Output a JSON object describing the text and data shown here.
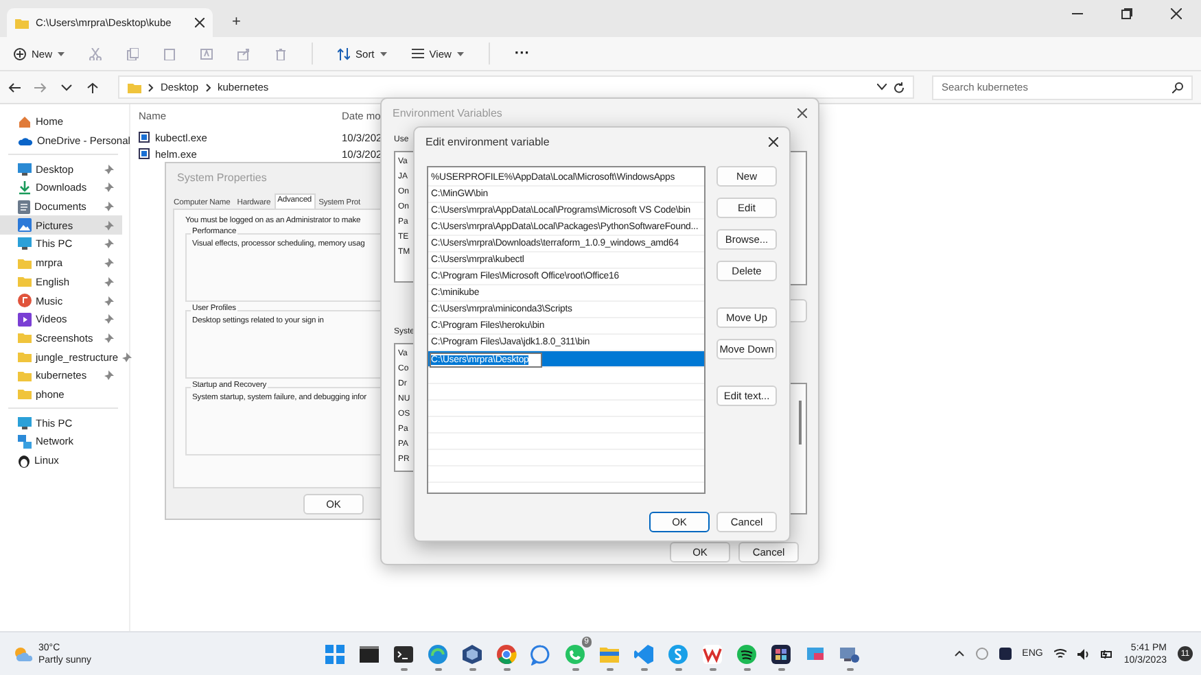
{
  "explorer": {
    "tab_title": "C:\\Users\\mrpra\\Desktop\\kube",
    "new_tab": "+",
    "toolbar": {
      "new": "New",
      "sort": "Sort",
      "view": "View",
      "more": "···"
    },
    "breadcrumb": [
      "Desktop",
      "kubernetes"
    ],
    "search": {
      "placeholder": "Search kubernetes"
    },
    "sidebar_top": [
      {
        "label": "Home",
        "kind": "home"
      },
      {
        "label": "OneDrive - Personal",
        "kind": "cloud"
      }
    ],
    "sidebar_quick": [
      {
        "label": "Desktop",
        "kind": "desktop",
        "selected": false,
        "pinned": true
      },
      {
        "label": "Downloads",
        "kind": "download",
        "selected": false,
        "pinned": true
      },
      {
        "label": "Documents",
        "kind": "document",
        "selected": false,
        "pinned": true
      },
      {
        "label": "Pictures",
        "kind": "pictures",
        "selected": true,
        "pinned": true
      },
      {
        "label": "This PC",
        "kind": "pc",
        "selected": false,
        "pinned": true
      },
      {
        "label": "mrpra",
        "kind": "folder",
        "selected": false,
        "pinned": true
      },
      {
        "label": "English",
        "kind": "folder",
        "selected": false,
        "pinned": true
      },
      {
        "label": "Music",
        "kind": "music",
        "selected": false,
        "pinned": true
      },
      {
        "label": "Videos",
        "kind": "video",
        "selected": false,
        "pinned": true
      },
      {
        "label": "Screenshots",
        "kind": "folder",
        "selected": false,
        "pinned": true
      },
      {
        "label": "jungle_restructure",
        "kind": "folder",
        "selected": false,
        "pinned": true
      },
      {
        "label": "kubernetes",
        "kind": "folder",
        "selected": false,
        "pinned": true
      },
      {
        "label": "phone",
        "kind": "folder",
        "selected": false,
        "pinned": false
      }
    ],
    "sidebar_bottom": [
      {
        "label": "This PC",
        "kind": "pc"
      },
      {
        "label": "Network",
        "kind": "network"
      },
      {
        "label": "Linux",
        "kind": "linux"
      }
    ],
    "columns": [
      "Name",
      "Date mo"
    ],
    "files": [
      {
        "name": "kubectl.exe",
        "date": "10/3/202"
      },
      {
        "name": "helm.exe",
        "date": "10/3/202"
      }
    ]
  },
  "system_properties": {
    "title": "System Properties",
    "tabs": [
      {
        "label": "Computer Name",
        "selected": false
      },
      {
        "label": "Hardware",
        "selected": false
      },
      {
        "label": "Advanced",
        "selected": true
      },
      {
        "label": "System Prot",
        "selected": false
      }
    ],
    "note": "You must be logged on as an Administrator to make",
    "groups": [
      {
        "title": "Performance",
        "text": "Visual effects, processor scheduling, memory usag"
      },
      {
        "title": "User Profiles",
        "text": "Desktop settings related to your sign in"
      },
      {
        "title": "Startup and Recovery",
        "text": "System startup, system failure, and debugging infor"
      }
    ],
    "buttons": [
      "OK"
    ]
  },
  "environment_variables": {
    "title": "Environment Variables",
    "user_label": "Use",
    "user_rows": [
      "Va",
      "JA",
      "On",
      "On",
      "Pa",
      "TE",
      "TM"
    ],
    "system_label": "Syste",
    "system_rows": [
      "Va",
      "Co",
      "Dr",
      "NU",
      "OS",
      "Pa",
      "PA",
      "PR"
    ],
    "buttons": [
      "OK",
      "Cancel"
    ]
  },
  "edit_variable": {
    "title": "Edit environment variable",
    "entries": [
      {
        "text": "%USERPROFILE%\\AppData\\Local\\Microsoft\\WindowsApps",
        "selected": false
      },
      {
        "text": "C:\\MinGW\\bin",
        "selected": false
      },
      {
        "text": "C:\\Users\\mrpra\\AppData\\Local\\Programs\\Microsoft VS Code\\bin",
        "selected": false
      },
      {
        "text": "C:\\Users\\mrpra\\AppData\\Local\\Packages\\PythonSoftwareFound...",
        "selected": false
      },
      {
        "text": "C:\\Users\\mrpra\\Downloads\\terraform_1.0.9_windows_amd64",
        "selected": false
      },
      {
        "text": "C:\\Users\\mrpra\\kubectl",
        "selected": false
      },
      {
        "text": "C:\\Program Files\\Microsoft Office\\root\\Office16",
        "selected": false
      },
      {
        "text": "C:\\minikube",
        "selected": false
      },
      {
        "text": "C:\\Users\\mrpra\\miniconda3\\Scripts",
        "selected": false
      },
      {
        "text": "C:\\Program Files\\heroku\\bin",
        "selected": false
      },
      {
        "text": "C:\\Program Files\\Java\\jdk1.8.0_311\\bin",
        "selected": false
      },
      {
        "text": "C:\\Users\\mrpra\\Desktop",
        "selected": true
      }
    ],
    "side_buttons": [
      [
        "New",
        "Edit",
        "Browse...",
        "Delete"
      ],
      [
        "Move Up",
        "Move Down"
      ],
      [
        "Edit text..."
      ]
    ],
    "buttons": [
      "OK",
      "Cancel"
    ]
  },
  "taskbar": {
    "weather": {
      "temperature": "30°C",
      "condition": "Partly sunny"
    },
    "apps": [
      {
        "kind": "start",
        "running": false
      },
      {
        "kind": "console",
        "running": false
      },
      {
        "kind": "terminal",
        "running": true
      },
      {
        "kind": "edge",
        "running": true
      },
      {
        "kind": "virtualbox",
        "running": true
      },
      {
        "kind": "chrome",
        "running": true
      },
      {
        "kind": "chat",
        "running": false
      },
      {
        "kind": "whatsapp",
        "running": true,
        "badge": "9"
      },
      {
        "kind": "files",
        "running": true
      },
      {
        "kind": "vscode",
        "running": true
      },
      {
        "kind": "skype",
        "running": true
      },
      {
        "kind": "wps",
        "running": true
      },
      {
        "kind": "spotify",
        "running": true
      },
      {
        "kind": "grid",
        "running": true
      },
      {
        "kind": "screen",
        "running": false
      },
      {
        "kind": "settings",
        "running": true
      }
    ],
    "language": "ENG",
    "time": "5:41 PM",
    "date": "10/3/2023",
    "notifications": "11"
  }
}
